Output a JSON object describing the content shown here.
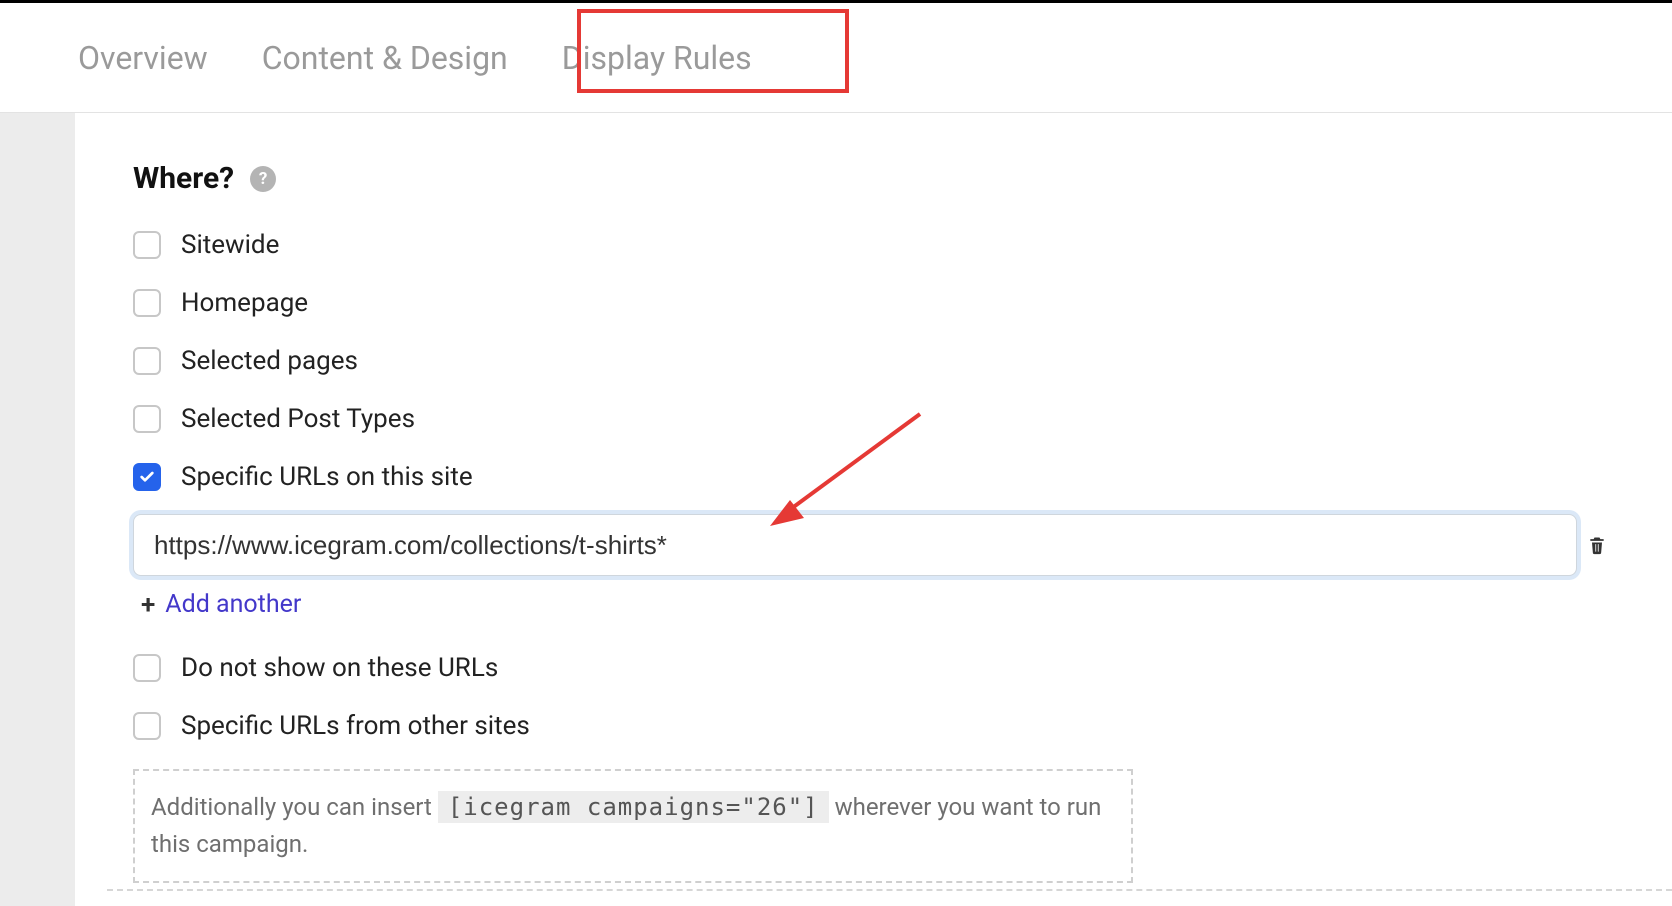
{
  "tabs": {
    "overview": "Overview",
    "content_design": "Content & Design",
    "display_rules": "Display Rules"
  },
  "section": {
    "title": "Where?"
  },
  "options": {
    "sitewide": "Sitewide",
    "homepage": "Homepage",
    "selected_pages": "Selected pages",
    "selected_post_types": "Selected Post Types",
    "specific_urls": "Specific URLs on this site",
    "do_not_show": "Do not show on these URLs",
    "other_sites": "Specific URLs from other sites"
  },
  "url_field": {
    "value": "https://www.icegram.com/collections/t-shirts*"
  },
  "add_another": {
    "label": "Add another"
  },
  "hint": {
    "prefix": "Additionally you can insert ",
    "code": "[icegram campaigns=\"26\"]",
    "suffix": " wherever you want to run this campaign."
  }
}
